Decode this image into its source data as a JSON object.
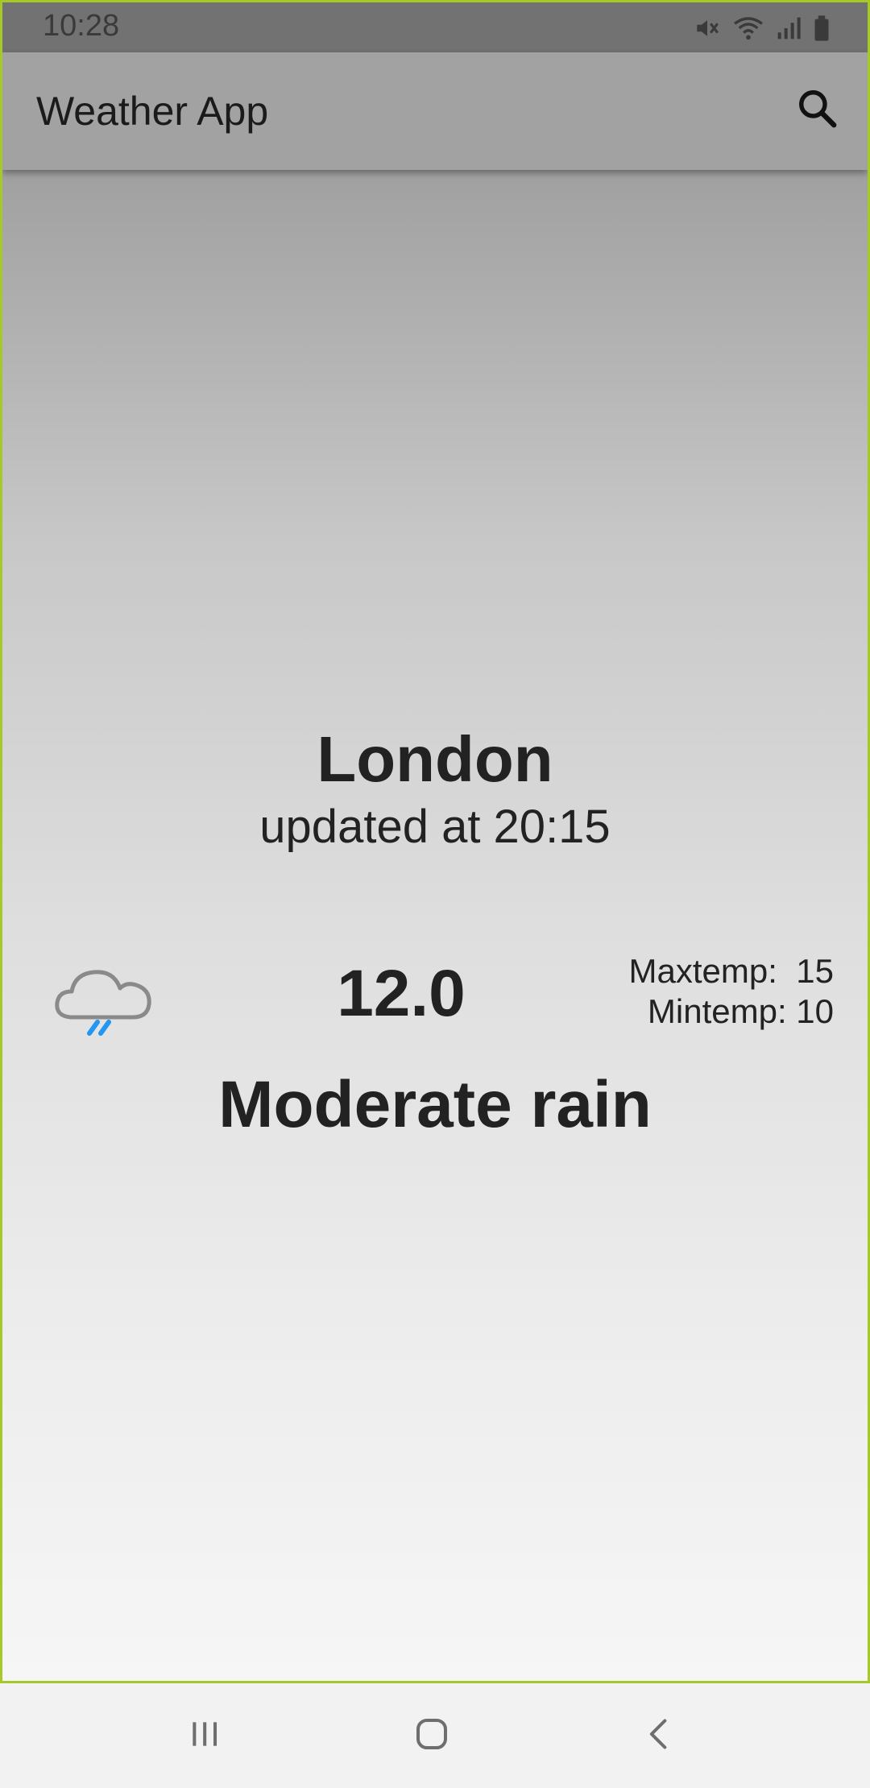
{
  "status_bar": {
    "time": "10:28",
    "icons": [
      "mute-icon",
      "wifi-icon",
      "signal-icon",
      "battery-icon"
    ]
  },
  "app_bar": {
    "title": "Weather App",
    "search_icon": "search-icon"
  },
  "weather": {
    "city": "London",
    "updated": "updated at 20:15",
    "temperature": "12.0",
    "max_temp_label": "Maxtemp:  15",
    "min_temp_label": "Mintemp: 10",
    "condition": "Moderate rain",
    "condition_icon": "rain-cloud-icon"
  },
  "nav_bar": {
    "buttons": [
      "recents-icon",
      "home-icon",
      "back-icon"
    ]
  },
  "colors": {
    "frame_border": "#a6c928",
    "status_bar_bg": "#727272",
    "app_bar_bg": "#a2a2a2",
    "rain_drop": "#2196f3",
    "cloud_outline": "#8a8a8a"
  }
}
